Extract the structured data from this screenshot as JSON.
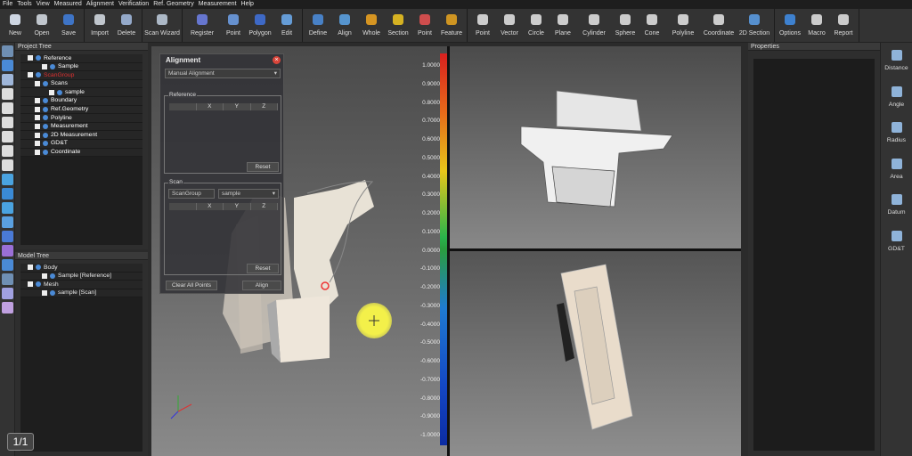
{
  "menu": [
    "File",
    "Tools",
    "View",
    "Measured",
    "Alignment",
    "Verification",
    "Ref. Geometry",
    "Measurement",
    "Help"
  ],
  "toolbar": {
    "groups": [
      {
        "items": [
          {
            "label": "New",
            "icon": "new-file-icon",
            "color": "#dfe8f5"
          },
          {
            "label": "Open",
            "icon": "open-folder-icon",
            "color": "#cfd6de"
          },
          {
            "label": "Save",
            "icon": "save-disk-icon",
            "color": "#3f7bd6"
          }
        ]
      },
      {
        "items": [
          {
            "label": "Import",
            "icon": "import-icon",
            "color": "#cfd6de"
          },
          {
            "label": "Delete",
            "icon": "delete-icon",
            "color": "#9fb6d9"
          }
        ]
      },
      {
        "items": [
          {
            "label": "Scan Wizard",
            "icon": "scan-wizard-icon",
            "color": "#b9c6d6"
          }
        ]
      },
      {
        "items": [
          {
            "label": "Register",
            "icon": "register-icon",
            "color": "#6b7de0"
          },
          {
            "label": "Point",
            "icon": "point-register-icon",
            "color": "#6b9be0"
          },
          {
            "label": "Polygon",
            "icon": "polygon-icon",
            "color": "#3f6fd6"
          },
          {
            "label": "Edit",
            "icon": "edit-icon",
            "color": "#6aa7e8"
          }
        ]
      },
      {
        "items": [
          {
            "label": "Define",
            "icon": "define-icon",
            "color": "#4a8ad6"
          },
          {
            "label": "Align",
            "icon": "align-icon",
            "color": "#5aa0e0"
          },
          {
            "label": "Whole",
            "icon": "whole-icon",
            "color": "#e8a020"
          },
          {
            "label": "Section",
            "icon": "section-icon",
            "color": "#e8c020"
          },
          {
            "label": "Point",
            "icon": "point-compare-icon",
            "color": "#e05050"
          },
          {
            "label": "Feature",
            "icon": "feature-icon",
            "color": "#e0a020"
          }
        ]
      },
      {
        "items": [
          {
            "label": "Point",
            "icon": "point-feature-icon",
            "color": "#dddddd"
          },
          {
            "label": "Vector",
            "icon": "vector-icon",
            "color": "#dddddd"
          },
          {
            "label": "Circle",
            "icon": "circle-icon",
            "color": "#dddddd"
          },
          {
            "label": "Plane",
            "icon": "plane-icon",
            "color": "#dddddd"
          },
          {
            "label": "Cylinder",
            "icon": "cylinder-icon",
            "color": "#dddddd"
          },
          {
            "label": "Sphere",
            "icon": "sphere-icon",
            "color": "#dddddd"
          },
          {
            "label": "Cone",
            "icon": "cone-icon",
            "color": "#dddddd"
          },
          {
            "label": "Polyline",
            "icon": "polyline-icon",
            "color": "#dddddd"
          },
          {
            "label": "Coordinate",
            "icon": "coordinate-icon",
            "color": "#dddddd"
          },
          {
            "label": "2D Section",
            "icon": "2d-section-icon",
            "color": "#5a9ae0"
          }
        ]
      },
      {
        "items": [
          {
            "label": "Options",
            "icon": "options-gear-icon",
            "color": "#3f8ae0"
          },
          {
            "label": "Macro",
            "icon": "macro-icon",
            "color": "#dddddd"
          },
          {
            "label": "Report",
            "icon": "report-icon",
            "color": "#dddddd"
          }
        ]
      }
    ]
  },
  "project_tree": {
    "title": "Project Tree",
    "rows": [
      {
        "label": "Reference",
        "indent": 1,
        "color": "#ffffff"
      },
      {
        "label": "Sample",
        "indent": 3,
        "color": "#ffffff"
      },
      {
        "label": "ScanGroup",
        "indent": 1,
        "color": "#e03030"
      },
      {
        "label": "Scans",
        "indent": 2,
        "color": "#ffffff"
      },
      {
        "label": "sample",
        "indent": 4,
        "color": "#ffffff"
      },
      {
        "label": "Boundary",
        "indent": 2,
        "color": "#ffffff"
      },
      {
        "label": "Ref.Geometry",
        "indent": 2,
        "color": "#ffffff"
      },
      {
        "label": "Polyline",
        "indent": 2,
        "color": "#ffffff"
      },
      {
        "label": "Measurement",
        "indent": 2,
        "color": "#ffffff"
      },
      {
        "label": "2D Measurement",
        "indent": 2,
        "color": "#ffffff"
      },
      {
        "label": "GD&T",
        "indent": 2,
        "color": "#ffffff"
      },
      {
        "label": "Coordinate",
        "indent": 2,
        "color": "#ffffff"
      }
    ]
  },
  "model_tree": {
    "title": "Model Tree",
    "rows": [
      {
        "label": "Body",
        "indent": 1
      },
      {
        "label": "Sample [Reference]",
        "indent": 3
      },
      {
        "label": "Mesh",
        "indent": 1
      },
      {
        "label": "sample [Scan]",
        "indent": 3
      }
    ]
  },
  "properties": {
    "title": "Properties"
  },
  "alignment_dialog": {
    "title": "Alignment",
    "mode": "Manual Alignment",
    "reference_label": "Reference",
    "scan_label": "Scan",
    "columns": [
      "",
      "X",
      "Y",
      "Z"
    ],
    "reset_label": "Reset",
    "scan_group_value": "ScanGroup",
    "scan_value": "sample",
    "clear_label": "Clear All Points",
    "align_label": "Align"
  },
  "color_scale": [
    "1.0000",
    "0.9000",
    "0.8000",
    "0.7000",
    "0.6000",
    "0.5000",
    "0.4000",
    "0.3000",
    "0.2000",
    "0.1000",
    "0.0000",
    "-0.1000",
    "-0.2000",
    "-0.3000",
    "-0.4000",
    "-0.5000",
    "-0.6000",
    "-0.7000",
    "-0.8000",
    "-0.9000",
    "-1.0000"
  ],
  "right_tools": [
    {
      "label": "Distance",
      "icon": "distance-icon"
    },
    {
      "label": "Angle",
      "icon": "angle-icon"
    },
    {
      "label": "Radius",
      "icon": "radius-icon"
    },
    {
      "label": "Area",
      "icon": "area-icon"
    },
    {
      "label": "Datum",
      "icon": "datum-icon"
    },
    {
      "label": "GD&T",
      "icon": "gdt-icon"
    }
  ],
  "page_indicator": "1/1",
  "colors": {
    "accent": "#3f7bd6",
    "warning": "#e03030"
  }
}
